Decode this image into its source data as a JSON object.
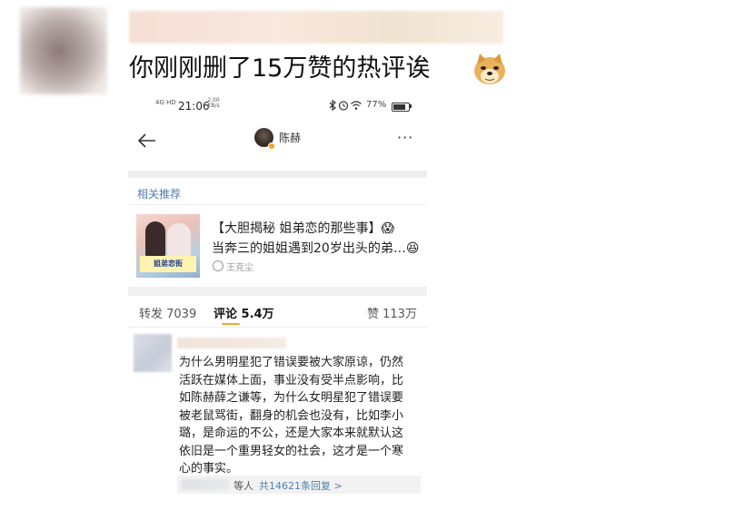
{
  "post": {
    "text": "你刚刚删了15万赞的热评诶",
    "emoji_icon": "doge-emoji-icon"
  },
  "phone": {
    "status_bar": {
      "signal_text": "4G HD",
      "time": "21:06",
      "speed": "2.00 KB/s",
      "battery": "77%",
      "icons": [
        "bluetooth-icon",
        "alarm-icon",
        "wifi-icon",
        "battery-icon"
      ]
    },
    "nav": {
      "back_icon": "back-arrow-icon",
      "profile_name": "陈赫",
      "more_icon": "more-dots-icon",
      "more_text": "···"
    },
    "related": {
      "label": "相关推荐",
      "card": {
        "title_line1": "【大胆揭秘 姐弟恋的那些事】😱",
        "title_line2": "当奔三的姐姐遇到20岁出头的弟…😆",
        "author": "王克尘",
        "thumb_caption": "姐弟恋街"
      }
    },
    "tabs": {
      "reposts": "转发 7039",
      "comments": "评论 5.4万",
      "likes": "赞 113万"
    },
    "comment": {
      "text": "为什么男明星犯了错误要被大家原谅，仍然\n活跃在媒体上面，事业没有受半点影响，比\n如陈赫薛之谦等，为什么女明星犯了错误要\n被老鼠骂街，翻身的机会也没有，比如李小\n璐，是命运的不公，还是大家本来就默认这\n依旧是一个重男轻女的社会，这才是一个寒\n心的事实。",
      "reply_etc": "等人",
      "reply_link": "共14621条回复 >"
    }
  }
}
